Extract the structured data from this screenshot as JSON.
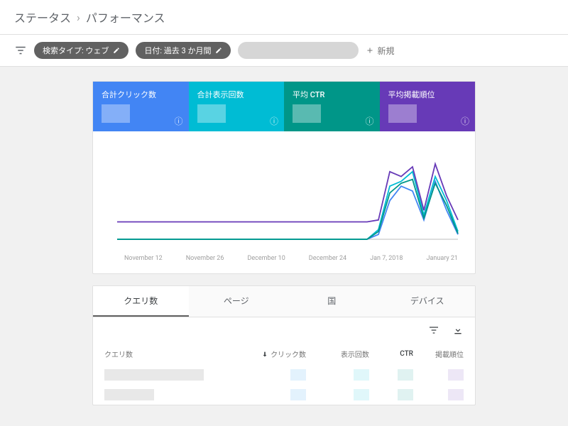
{
  "breadcrumb": {
    "item1": "ステータス",
    "sep": "›",
    "item2": "パフォーマンス"
  },
  "filters": {
    "chip1": "検索タイプ: ウェブ",
    "chip2": "日付: 過去 3 か月間",
    "new_label": "新規"
  },
  "metrics": [
    {
      "label": "合計クリック数"
    },
    {
      "label": "合計表示回数"
    },
    {
      "label": "平均 CTR"
    },
    {
      "label": "平均掲載順位"
    }
  ],
  "chart_data": {
    "type": "line",
    "title": "",
    "xlabel": "",
    "ylabel": "",
    "categories": [
      "November 12",
      "November 26",
      "December 10",
      "December 24",
      "Jan 7, 2018",
      "January 21"
    ],
    "series": [
      {
        "name": "合計クリック数",
        "color": "#4285f4",
        "values": [
          0,
          0,
          0,
          0,
          0,
          0,
          0,
          0,
          0,
          0,
          0,
          0,
          0,
          0,
          0,
          0,
          0,
          0,
          0,
          0,
          0,
          0,
          0,
          5,
          40,
          55,
          50,
          20,
          60,
          30,
          5
        ]
      },
      {
        "name": "合計表示回数",
        "color": "#00bcd4",
        "values": [
          0,
          0,
          0,
          0,
          0,
          0,
          0,
          0,
          0,
          0,
          0,
          0,
          0,
          0,
          0,
          0,
          0,
          0,
          0,
          0,
          0,
          0,
          0,
          10,
          55,
          60,
          70,
          25,
          65,
          40,
          8
        ]
      },
      {
        "name": "平均 CTR",
        "color": "#009688",
        "values": [
          0,
          0,
          0,
          0,
          0,
          0,
          0,
          0,
          0,
          0,
          0,
          0,
          0,
          0,
          0,
          0,
          0,
          0,
          0,
          0,
          0,
          0,
          0,
          8,
          48,
          58,
          62,
          22,
          58,
          35,
          6
        ]
      },
      {
        "name": "平均掲載順位",
        "color": "#673ab7",
        "values": [
          18,
          18,
          18,
          18,
          18,
          18,
          18,
          18,
          18,
          18,
          18,
          18,
          18,
          18,
          18,
          18,
          18,
          18,
          18,
          18,
          18,
          18,
          18,
          20,
          70,
          65,
          75,
          30,
          78,
          45,
          20
        ]
      }
    ],
    "ylim": [
      0,
      100
    ]
  },
  "tabs": {
    "items": [
      "クエリ数",
      "ページ",
      "国",
      "デバイス"
    ],
    "active": 0
  },
  "table": {
    "headers": {
      "query": "クエリ数",
      "clicks": "クリック数",
      "impressions": "表示回数",
      "ctr": "CTR",
      "position": "掲載順位"
    }
  }
}
